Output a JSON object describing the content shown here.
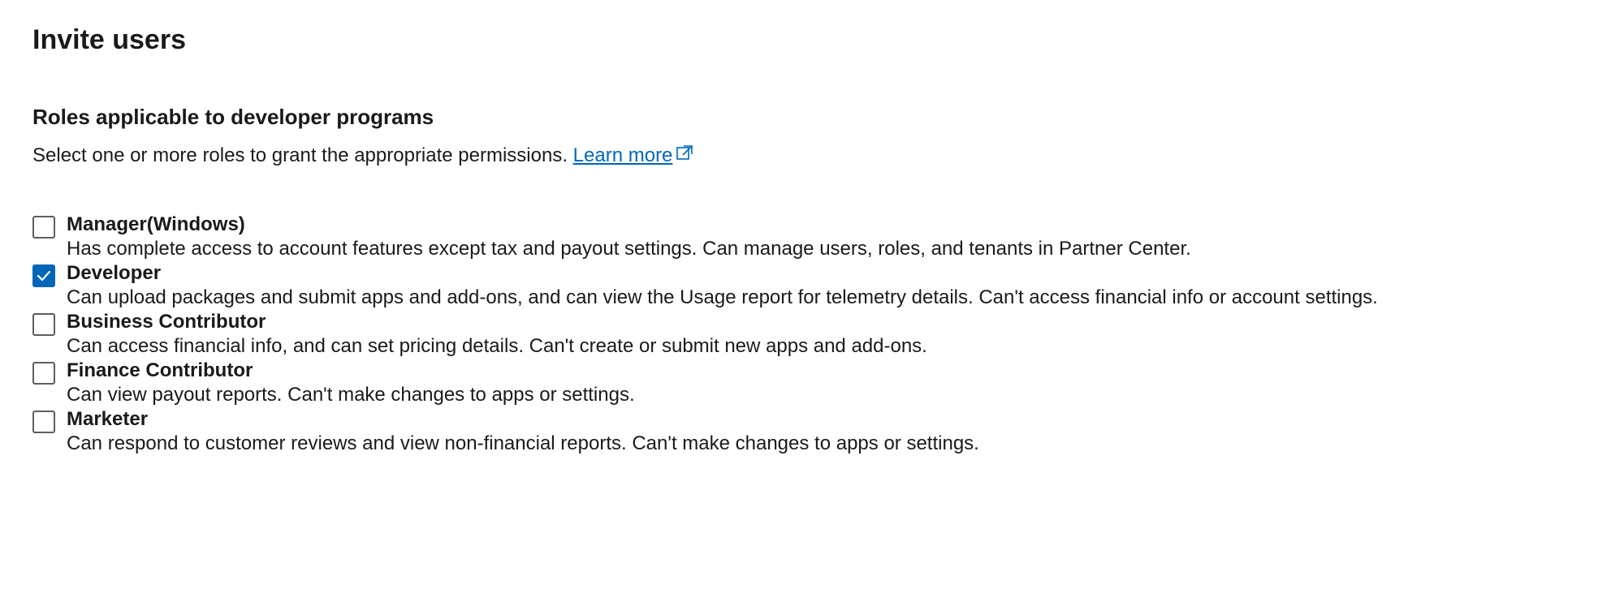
{
  "page": {
    "title": "Invite users"
  },
  "section": {
    "heading": "Roles applicable to developer programs",
    "description": "Select one or more roles to grant the appropriate permissions. ",
    "learn_more": "Learn more"
  },
  "roles": [
    {
      "label": "Manager(Windows)",
      "description": "Has complete access to account features except tax and payout settings. Can manage users, roles, and tenants in Partner Center.",
      "checked": false
    },
    {
      "label": "Developer",
      "description": "Can upload packages and submit apps and add-ons, and can view the Usage report for telemetry details. Can't access financial info or account settings.",
      "checked": true
    },
    {
      "label": "Business Contributor",
      "description": "Can access financial info, and can set pricing details. Can't create or submit new apps and add-ons.",
      "checked": false
    },
    {
      "label": "Finance Contributor",
      "description": "Can view payout reports. Can't make changes to apps or settings.",
      "checked": false
    },
    {
      "label": "Marketer",
      "description": "Can respond to customer reviews and view non-financial reports. Can't make changes to apps or settings.",
      "checked": false
    }
  ]
}
